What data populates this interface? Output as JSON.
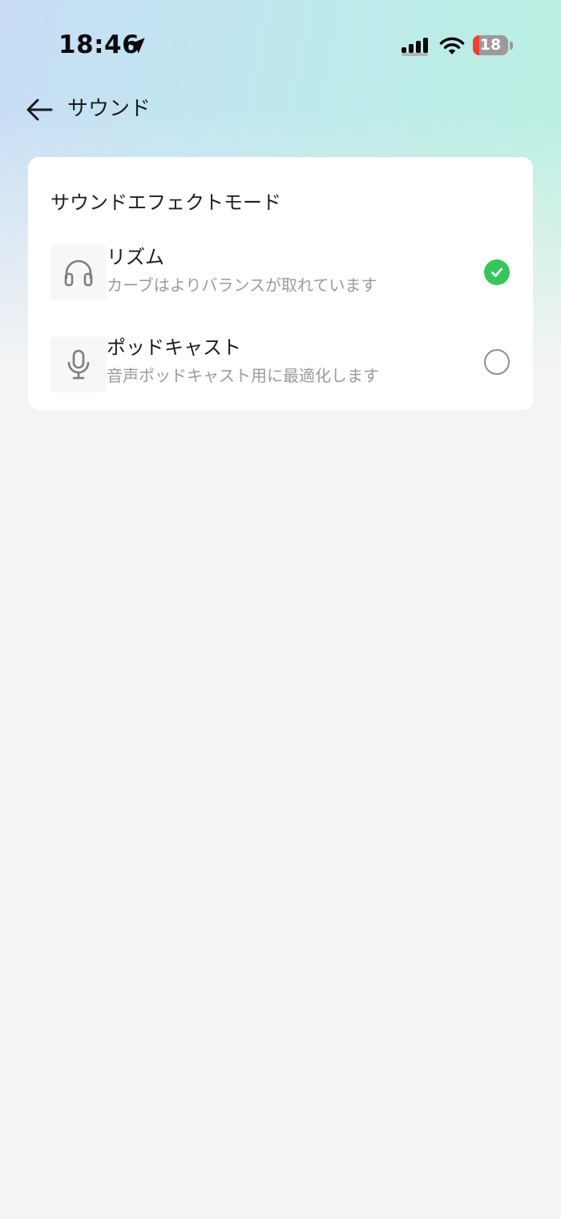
{
  "status_bar": {
    "time": "18:46",
    "battery_level": "18",
    "battery_fraction": 0.18,
    "icons": [
      "location-arrow-icon",
      "cellular-signal-icon",
      "wifi-icon",
      "battery-icon"
    ]
  },
  "header": {
    "back_icon": "arrow-left-icon",
    "title": "サウンド"
  },
  "sound_effect": {
    "section_title": "サウンドエフェクトモード",
    "options": [
      {
        "icon": "headphones-icon",
        "title": "リズム",
        "description": "カーブはよりバランスが取れています",
        "selected": true
      },
      {
        "icon": "microphone-icon",
        "title": "ポッドキャスト",
        "description": "音声ポッドキャスト用に最適化します",
        "selected": false
      }
    ]
  },
  "colors": {
    "accent_selected": "#34c759",
    "battery_low": "#ff3b30"
  }
}
